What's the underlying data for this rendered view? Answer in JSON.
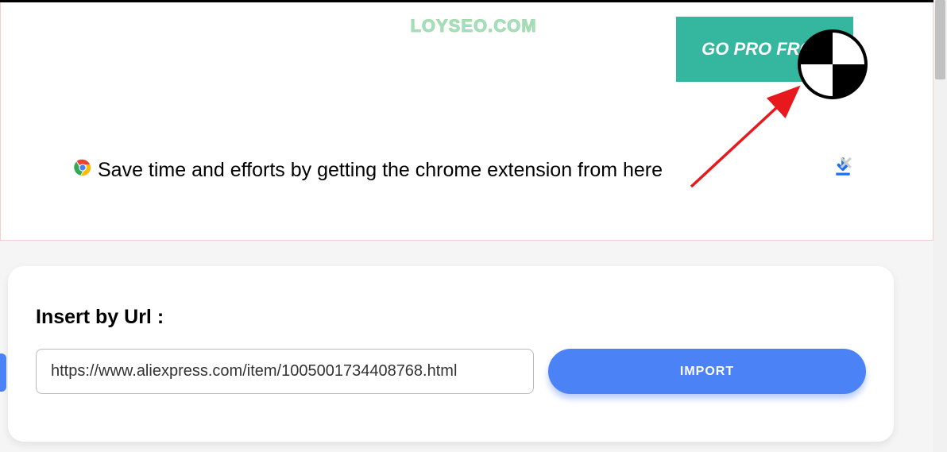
{
  "watermark": "LOYSEO.COM",
  "header": {
    "go_pro_label": "GO PRO FROM"
  },
  "banner": {
    "text": "Save time and efforts by getting the chrome extension from here ",
    "close_symbol": "✕"
  },
  "insert_panel": {
    "title": "Insert by Url :",
    "url_value": "https://www.aliexpress.com/item/1005001734408768.html",
    "import_label": "IMPORT"
  }
}
